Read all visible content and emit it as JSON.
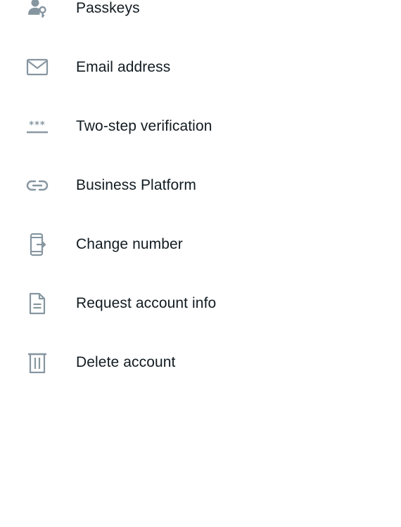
{
  "settings": {
    "items": [
      {
        "label": "Passkeys",
        "icon": "passkey-icon"
      },
      {
        "label": "Email address",
        "icon": "envelope-icon"
      },
      {
        "label": "Two-step verification",
        "icon": "asterisk-password-icon"
      },
      {
        "label": "Business Platform",
        "icon": "link-icon"
      },
      {
        "label": "Change number",
        "icon": "phone-transfer-icon"
      },
      {
        "label": "Request account info",
        "icon": "document-icon"
      },
      {
        "label": "Delete account",
        "icon": "trash-icon"
      }
    ]
  },
  "colors": {
    "icon": "#8696a0",
    "text": "#111b21",
    "background": "#ffffff"
  }
}
